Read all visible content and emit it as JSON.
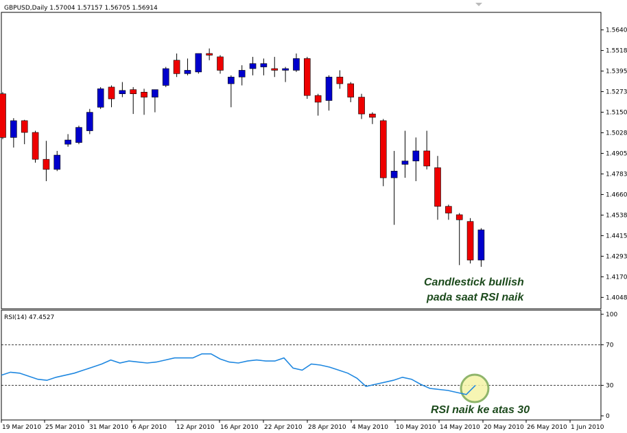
{
  "chart_data": [
    {
      "type": "candlestick",
      "title": "GBPUSD,Daily  1.57004 1.57157 1.56705 1.56914",
      "ylim": [
        1.398,
        1.5745
      ],
      "y_ticks": [
        "1.56405",
        "1.55180",
        "1.53955",
        "1.52730",
        "1.51505",
        "1.50280",
        "1.49055",
        "1.47830",
        "1.46605",
        "1.45380",
        "1.44155",
        "1.42930",
        "1.41705",
        "1.40480"
      ],
      "x_tick_labels": [
        "19 Mar 2010",
        "25 Mar 2010",
        "31 Mar 2010",
        "6 Apr 2010",
        "12 Apr 2010",
        "16 Apr 2010",
        "22 Apr 2010",
        "28 Apr 2010",
        "4 May 2010",
        "10 May 2010",
        "14 May 2010",
        "20 May 2010",
        "26 May 2010",
        "1 Jun 2010"
      ],
      "candles": [
        {
          "o": 1.526,
          "h": 1.527,
          "l": 1.499,
          "c": 1.5
        },
        {
          "o": 1.5,
          "h": 1.5115,
          "l": 1.494,
          "c": 1.51
        },
        {
          "o": 1.51,
          "h": 1.5105,
          "l": 1.496,
          "c": 1.503
        },
        {
          "o": 1.503,
          "h": 1.504,
          "l": 1.485,
          "c": 1.487
        },
        {
          "o": 1.487,
          "h": 1.498,
          "l": 1.474,
          "c": 1.481
        },
        {
          "o": 1.481,
          "h": 1.492,
          "l": 1.48,
          "c": 1.4895
        },
        {
          "o": 1.496,
          "h": 1.502,
          "l": 1.4945,
          "c": 1.4985
        },
        {
          "o": 1.497,
          "h": 1.507,
          "l": 1.496,
          "c": 1.506
        },
        {
          "o": 1.504,
          "h": 1.517,
          "l": 1.502,
          "c": 1.515
        },
        {
          "o": 1.518,
          "h": 1.53,
          "l": 1.517,
          "c": 1.529
        },
        {
          "o": 1.53,
          "h": 1.531,
          "l": 1.518,
          "c": 1.523
        },
        {
          "o": 1.526,
          "h": 1.533,
          "l": 1.524,
          "c": 1.528
        },
        {
          "o": 1.5285,
          "h": 1.53,
          "l": 1.514,
          "c": 1.526
        },
        {
          "o": 1.527,
          "h": 1.529,
          "l": 1.5135,
          "c": 1.524
        },
        {
          "o": 1.524,
          "h": 1.5285,
          "l": 1.515,
          "c": 1.5285
        },
        {
          "o": 1.531,
          "h": 1.542,
          "l": 1.53,
          "c": 1.541
        },
        {
          "o": 1.546,
          "h": 1.55,
          "l": 1.536,
          "c": 1.538
        },
        {
          "o": 1.538,
          "h": 1.547,
          "l": 1.537,
          "c": 1.54
        },
        {
          "o": 1.539,
          "h": 1.55,
          "l": 1.538,
          "c": 1.55
        },
        {
          "o": 1.55,
          "h": 1.553,
          "l": 1.546,
          "c": 1.549
        },
        {
          "o": 1.548,
          "h": 1.549,
          "l": 1.538,
          "c": 1.54
        },
        {
          "o": 1.532,
          "h": 1.537,
          "l": 1.518,
          "c": 1.536
        },
        {
          "o": 1.536,
          "h": 1.543,
          "l": 1.531,
          "c": 1.54
        },
        {
          "o": 1.541,
          "h": 1.548,
          "l": 1.537,
          "c": 1.544
        },
        {
          "o": 1.542,
          "h": 1.547,
          "l": 1.537,
          "c": 1.544
        },
        {
          "o": 1.541,
          "h": 1.548,
          "l": 1.536,
          "c": 1.54
        },
        {
          "o": 1.54,
          "h": 1.542,
          "l": 1.533,
          "c": 1.541
        },
        {
          "o": 1.54,
          "h": 1.55,
          "l": 1.539,
          "c": 1.547
        },
        {
          "o": 1.547,
          "h": 1.548,
          "l": 1.523,
          "c": 1.525
        },
        {
          "o": 1.525,
          "h": 1.526,
          "l": 1.513,
          "c": 1.521
        },
        {
          "o": 1.522,
          "h": 1.537,
          "l": 1.516,
          "c": 1.536
        },
        {
          "o": 1.536,
          "h": 1.54,
          "l": 1.529,
          "c": 1.532
        },
        {
          "o": 1.532,
          "h": 1.533,
          "l": 1.521,
          "c": 1.524
        },
        {
          "o": 1.524,
          "h": 1.526,
          "l": 1.511,
          "c": 1.514
        },
        {
          "o": 1.514,
          "h": 1.515,
          "l": 1.508,
          "c": 1.512
        },
        {
          "o": 1.51,
          "h": 1.511,
          "l": 1.471,
          "c": 1.476
        },
        {
          "o": 1.476,
          "h": 1.492,
          "l": 1.448,
          "c": 1.48
        },
        {
          "o": 1.484,
          "h": 1.504,
          "l": 1.476,
          "c": 1.486
        },
        {
          "o": 1.486,
          "h": 1.5,
          "l": 1.474,
          "c": 1.492
        },
        {
          "o": 1.492,
          "h": 1.504,
          "l": 1.481,
          "c": 1.483
        },
        {
          "o": 1.482,
          "h": 1.489,
          "l": 1.451,
          "c": 1.459
        },
        {
          "o": 1.459,
          "h": 1.46,
          "l": 1.451,
          "c": 1.455
        },
        {
          "o": 1.454,
          "h": 1.455,
          "l": 1.424,
          "c": 1.451
        },
        {
          "o": 1.45,
          "h": 1.452,
          "l": 1.425,
          "c": 1.427
        },
        {
          "o": 1.427,
          "h": 1.446,
          "l": 1.423,
          "c": 1.445
        }
      ],
      "colors": {
        "bull": "#0000cc",
        "bear": "#ee0000",
        "wick": "#000000"
      },
      "annotation": "Candlestick bullish pada saat RSI naik"
    },
    {
      "type": "line",
      "title": "RSI(14) 47.4527",
      "ylim": [
        0,
        100
      ],
      "y_ticks": [
        "100",
        "70",
        "30",
        "0"
      ],
      "levels": [
        70,
        30
      ],
      "series": [
        {
          "color": "#1e87e0",
          "values": [
            40,
            43,
            42,
            39,
            36,
            35,
            38,
            40,
            42,
            45,
            48,
            51,
            55,
            52,
            54,
            53,
            52,
            53,
            55,
            57,
            57,
            57,
            61,
            61,
            56,
            53,
            52,
            54,
            55,
            54,
            54,
            57,
            47,
            45,
            51,
            50,
            48,
            45,
            42,
            37,
            29,
            31,
            33,
            35,
            38,
            36,
            31,
            27,
            26,
            25,
            23,
            21,
            30
          ]
        }
      ],
      "annotation": "RSI naik ke atas 30"
    }
  ]
}
